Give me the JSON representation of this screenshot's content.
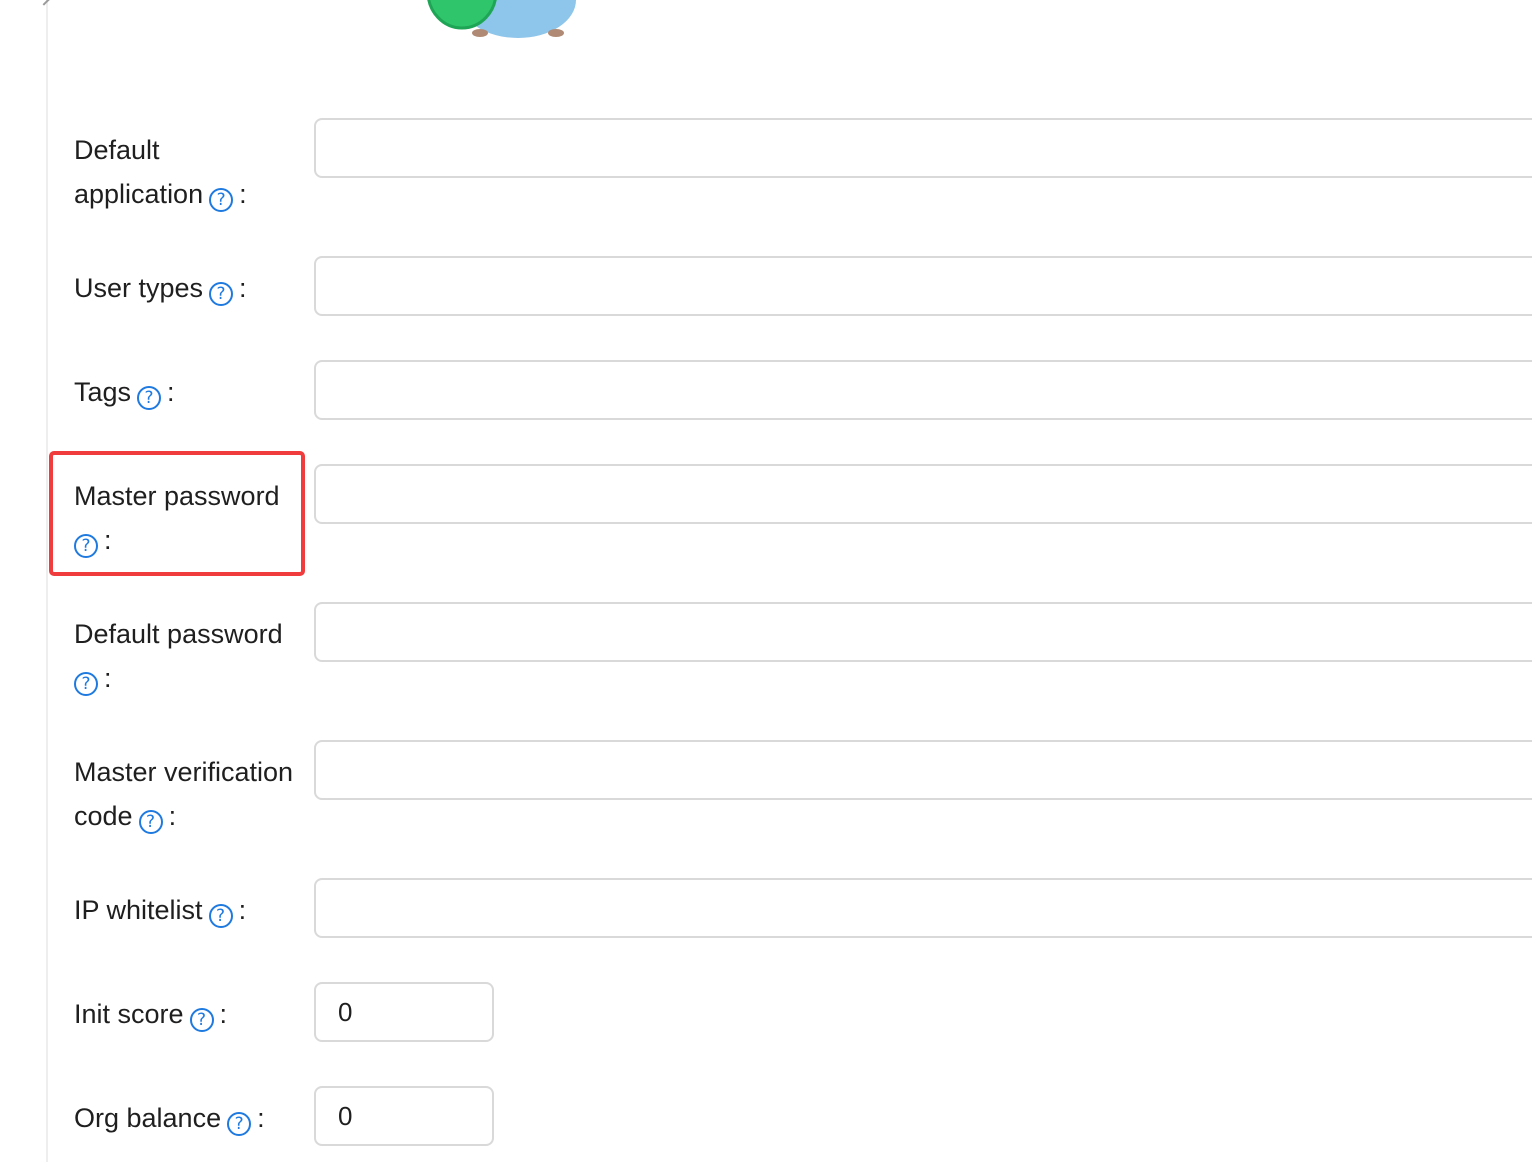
{
  "form": {
    "fields": [
      {
        "key": "default_application",
        "label_line1": "Default",
        "label_line2": "application",
        "value": ""
      },
      {
        "key": "user_types",
        "label": "User types",
        "value": ""
      },
      {
        "key": "tags",
        "label": "Tags",
        "value": ""
      },
      {
        "key": "master_password",
        "label_line1": "Master password",
        "value": ""
      },
      {
        "key": "default_password",
        "label_line1": "Default password",
        "value": ""
      },
      {
        "key": "master_verification_code",
        "label_line1": "Master verification",
        "label_line2": "code",
        "value": ""
      },
      {
        "key": "ip_whitelist",
        "label": "IP whitelist",
        "value": ""
      },
      {
        "key": "init_score",
        "label": "Init score",
        "value": "0"
      },
      {
        "key": "org_balance",
        "label": "Org balance",
        "value": "0"
      }
    ],
    "help_glyph": "?",
    "colon": ":"
  },
  "colors": {
    "help_icon": "#1f7ae0",
    "highlight": "#f03c3c",
    "input_border": "#d9d9d9"
  },
  "icons": {
    "help": "question-circle-icon",
    "mascot": "mascot-illustration"
  }
}
